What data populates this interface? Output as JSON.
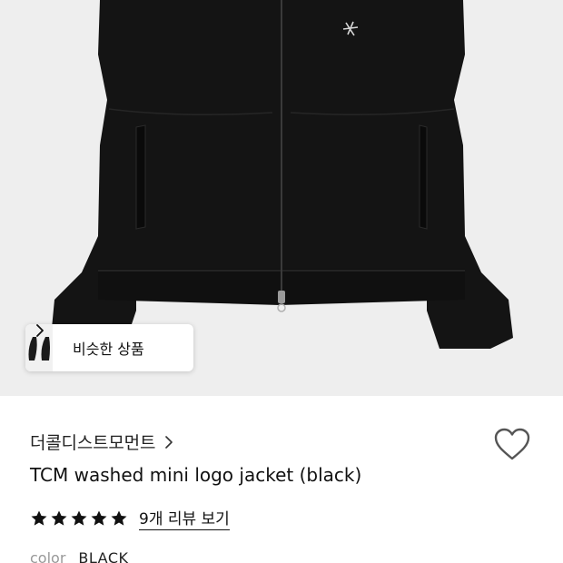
{
  "product_image": {
    "alt_icon": "black-jacket-photo"
  },
  "similar": {
    "label": "비슷한 상품",
    "chevron_icon": "chevron-right-icon"
  },
  "brand": {
    "name": "더콜디스트모먼트",
    "chevron_icon": "chevron-right-icon"
  },
  "wishlist": {
    "icon": "heart-icon"
  },
  "product": {
    "title": "TCM washed mini logo jacket (black)"
  },
  "rating": {
    "stars": 5,
    "star_icon": "star-icon",
    "review_link": "9개 리뷰 보기"
  },
  "color": {
    "label": "color",
    "value": "BLACK"
  },
  "colors": {
    "hero_bg": "#eeeeee",
    "jacket": "#141414",
    "text": "#111111",
    "muted": "#999999"
  }
}
